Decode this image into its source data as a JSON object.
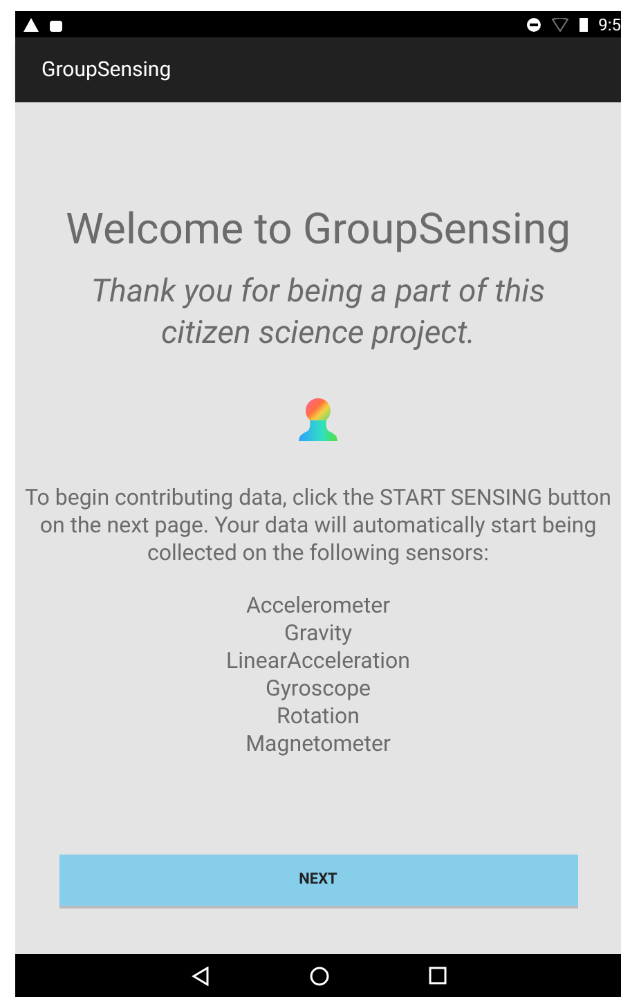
{
  "status_bar": {
    "time": "9:5"
  },
  "app_bar": {
    "title": "GroupSensing"
  },
  "welcome": {
    "heading": "Welcome to GroupSensing",
    "subheading": "Thank you for being a part of this citizen science project.",
    "intro": "To begin contributing data, click the START SENSING button on the next page. Your data will automatically start being collected on the following sensors:"
  },
  "sensors": [
    "Accelerometer",
    "Gravity",
    "LinearAcceleration",
    "Gyroscope",
    "Rotation",
    "Magnetometer"
  ],
  "next_button": {
    "label": "NEXT"
  }
}
